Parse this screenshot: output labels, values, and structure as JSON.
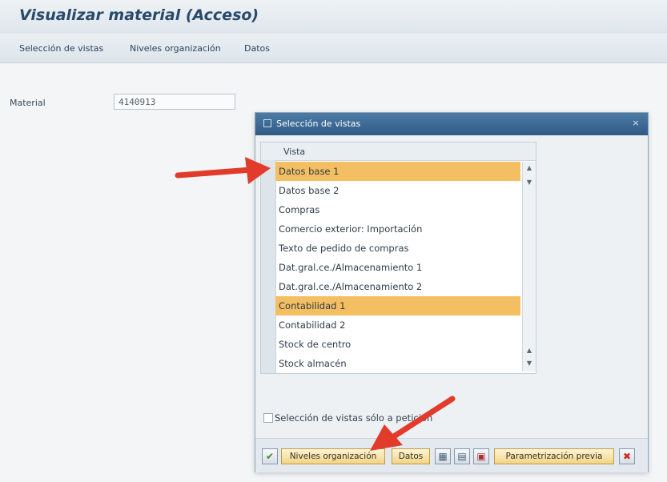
{
  "window": {
    "title": "Visualizar material (Acceso)"
  },
  "menu": {
    "items": [
      "Selección de vistas",
      "Niveles organización",
      "Datos"
    ]
  },
  "material": {
    "label": "Material",
    "value": "4140913"
  },
  "dialog": {
    "title": "Selección de vistas",
    "column_header": "Vista",
    "rows": [
      {
        "label": "Datos base 1",
        "selected": true
      },
      {
        "label": "Datos base 2",
        "selected": false
      },
      {
        "label": "Compras",
        "selected": false
      },
      {
        "label": "Comercio exterior: Importación",
        "selected": false
      },
      {
        "label": "Texto de pedido de compras",
        "selected": false
      },
      {
        "label": "Dat.gral.ce./Almacenamiento 1",
        "selected": false
      },
      {
        "label": "Dat.gral.ce./Almacenamiento 2",
        "selected": false
      },
      {
        "label": "Contabilidad 1",
        "selected": true
      },
      {
        "label": "Contabilidad 2",
        "selected": false
      },
      {
        "label": "Stock de centro",
        "selected": false
      },
      {
        "label": "Stock almacén",
        "selected": false
      }
    ],
    "checkbox_label": "Selección de vistas sólo a petición",
    "buttons": {
      "confirm_icon": "✔",
      "org_levels": "Niveles organización",
      "data": "Datos",
      "preview": "Parametrización previa",
      "cancel_icon": "✖"
    }
  },
  "colors": {
    "title": "#294a6b",
    "selected_row": "#f4bf62",
    "dialog_header": "#2f5b86",
    "annotation_arrow": "#e23b2b"
  }
}
